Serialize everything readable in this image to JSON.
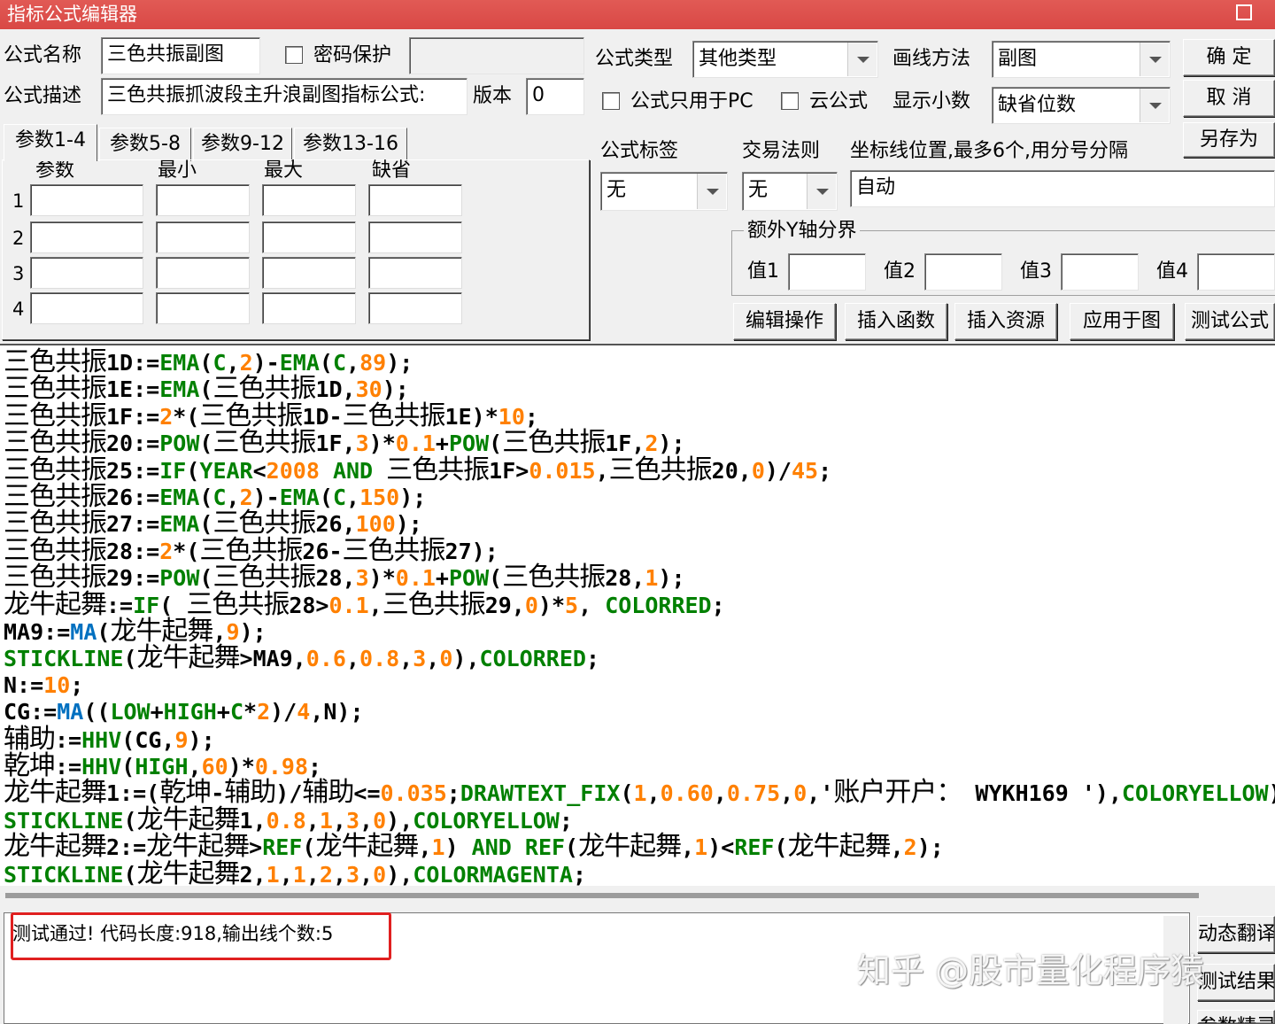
{
  "window": {
    "title": "指标公式编辑器",
    "maximize_icon": "maximize-icon"
  },
  "form": {
    "name_label": "公式名称",
    "name_value": "三色共振副图",
    "password_label": "密码保护",
    "desc_label": "公式描述",
    "desc_value": "三色共振抓波段主升浪副图指标公式:",
    "version_label": "版本",
    "version_value": "0",
    "type_label": "公式类型",
    "type_value": "其他类型",
    "draw_label": "画线方法",
    "draw_value": "副图",
    "pc_only_label": "公式只用于PC",
    "cloud_label": "云公式",
    "decimals_label": "显示小数",
    "decimals_value": "缺省位数",
    "tag_label": "公式标签",
    "tag_value": "无",
    "trade_label": "交易法则",
    "trade_value": "无",
    "axis_label": "坐标线位置,最多6个,用分号分隔",
    "axis_value": "自动",
    "extra_y_label": "额外Y轴分界",
    "val_labels": [
      "值1",
      "值2",
      "值3",
      "值4"
    ]
  },
  "buttons": {
    "ok": "确 定",
    "cancel": "取 消",
    "save_as": "另存为",
    "edit_ops": "编辑操作",
    "insert_func": "插入函数",
    "insert_res": "插入资源",
    "apply": "应用于图",
    "test": "测试公式",
    "dynamic": "动态翻译",
    "test_result": "测试结果",
    "param_tip": "参数精灵"
  },
  "tabs": [
    "参数1-4",
    "参数5-8",
    "参数9-12",
    "参数13-16"
  ],
  "param_headers": [
    "参数",
    "最小",
    "最大",
    "缺省"
  ],
  "param_rows": [
    "1",
    "2",
    "3",
    "4"
  ],
  "code_lines": [
    [
      [
        "z",
        "三色共振"
      ],
      [
        "k",
        "1D:="
      ],
      [
        "g",
        "EMA"
      ],
      [
        "k",
        "("
      ],
      [
        "g",
        "C"
      ],
      [
        "k",
        ","
      ],
      [
        "o",
        "2"
      ],
      [
        "k",
        ")-"
      ],
      [
        "g",
        "EMA"
      ],
      [
        "k",
        "("
      ],
      [
        "g",
        "C"
      ],
      [
        "k",
        ","
      ],
      [
        "o",
        "89"
      ],
      [
        "k",
        ");"
      ]
    ],
    [
      [
        "z",
        "三色共振"
      ],
      [
        "k",
        "1E:="
      ],
      [
        "g",
        "EMA"
      ],
      [
        "k",
        "("
      ],
      [
        "z",
        "三色共振"
      ],
      [
        "k",
        "1D,"
      ],
      [
        "o",
        "30"
      ],
      [
        "k",
        ");"
      ]
    ],
    [
      [
        "z",
        "三色共振"
      ],
      [
        "k",
        "1F:="
      ],
      [
        "o",
        "2"
      ],
      [
        "k",
        "*("
      ],
      [
        "z",
        "三色共振"
      ],
      [
        "k",
        "1D-"
      ],
      [
        "z",
        "三色共振"
      ],
      [
        "k",
        "1E)*"
      ],
      [
        "o",
        "10"
      ],
      [
        "k",
        ";"
      ]
    ],
    [
      [
        "z",
        "三色共振"
      ],
      [
        "k",
        "20:="
      ],
      [
        "g",
        "POW"
      ],
      [
        "k",
        "("
      ],
      [
        "z",
        "三色共振"
      ],
      [
        "k",
        "1F,"
      ],
      [
        "o",
        "3"
      ],
      [
        "k",
        ")*"
      ],
      [
        "o",
        "0.1"
      ],
      [
        "k",
        "+"
      ],
      [
        "g",
        "POW"
      ],
      [
        "k",
        "("
      ],
      [
        "z",
        "三色共振"
      ],
      [
        "k",
        "1F,"
      ],
      [
        "o",
        "2"
      ],
      [
        "k",
        ");"
      ]
    ],
    [
      [
        "z",
        "三色共振"
      ],
      [
        "k",
        "25:="
      ],
      [
        "g",
        "IF"
      ],
      [
        "k",
        "("
      ],
      [
        "g",
        "YEAR"
      ],
      [
        "k",
        "<"
      ],
      [
        "o",
        "2008"
      ],
      [
        "k",
        " "
      ],
      [
        "g",
        "AND"
      ],
      [
        "k",
        " "
      ],
      [
        "z",
        "三色共振"
      ],
      [
        "k",
        "1F>"
      ],
      [
        "o",
        "0.015"
      ],
      [
        "k",
        ","
      ],
      [
        "z",
        "三色共振"
      ],
      [
        "k",
        "20,"
      ],
      [
        "o",
        "0"
      ],
      [
        "k",
        ")/"
      ],
      [
        "o",
        "45"
      ],
      [
        "k",
        ";"
      ]
    ],
    [
      [
        "z",
        "三色共振"
      ],
      [
        "k",
        "26:="
      ],
      [
        "g",
        "EMA"
      ],
      [
        "k",
        "("
      ],
      [
        "g",
        "C"
      ],
      [
        "k",
        ","
      ],
      [
        "o",
        "2"
      ],
      [
        "k",
        ")-"
      ],
      [
        "g",
        "EMA"
      ],
      [
        "k",
        "("
      ],
      [
        "g",
        "C"
      ],
      [
        "k",
        ","
      ],
      [
        "o",
        "150"
      ],
      [
        "k",
        ");"
      ]
    ],
    [
      [
        "z",
        "三色共振"
      ],
      [
        "k",
        "27:="
      ],
      [
        "g",
        "EMA"
      ],
      [
        "k",
        "("
      ],
      [
        "z",
        "三色共振"
      ],
      [
        "k",
        "26,"
      ],
      [
        "o",
        "100"
      ],
      [
        "k",
        ");"
      ]
    ],
    [
      [
        "z",
        "三色共振"
      ],
      [
        "k",
        "28:="
      ],
      [
        "o",
        "2"
      ],
      [
        "k",
        "*("
      ],
      [
        "z",
        "三色共振"
      ],
      [
        "k",
        "26-"
      ],
      [
        "z",
        "三色共振"
      ],
      [
        "k",
        "27);"
      ]
    ],
    [
      [
        "z",
        "三色共振"
      ],
      [
        "k",
        "29:="
      ],
      [
        "g",
        "POW"
      ],
      [
        "k",
        "("
      ],
      [
        "z",
        "三色共振"
      ],
      [
        "k",
        "28,"
      ],
      [
        "o",
        "3"
      ],
      [
        "k",
        ")*"
      ],
      [
        "o",
        "0.1"
      ],
      [
        "k",
        "+"
      ],
      [
        "g",
        "POW"
      ],
      [
        "k",
        "("
      ],
      [
        "z",
        "三色共振"
      ],
      [
        "k",
        "28,"
      ],
      [
        "o",
        "1"
      ],
      [
        "k",
        ");"
      ]
    ],
    [
      [
        "z",
        "龙牛起舞"
      ],
      [
        "k",
        ":="
      ],
      [
        "g",
        "IF"
      ],
      [
        "k",
        "( "
      ],
      [
        "z",
        "三色共振"
      ],
      [
        "k",
        "28>"
      ],
      [
        "o",
        "0.1"
      ],
      [
        "k",
        ","
      ],
      [
        "z",
        "三色共振"
      ],
      [
        "k",
        "29,"
      ],
      [
        "o",
        "0"
      ],
      [
        "k",
        ")*"
      ],
      [
        "o",
        "5"
      ],
      [
        "k",
        ", "
      ],
      [
        "g",
        "COLORRED"
      ],
      [
        "k",
        ";"
      ]
    ],
    [
      [
        "k",
        "MA9:="
      ],
      [
        "b",
        "MA"
      ],
      [
        "k",
        "("
      ],
      [
        "z",
        "龙牛起舞"
      ],
      [
        "k",
        ","
      ],
      [
        "o",
        "9"
      ],
      [
        "k",
        ");"
      ]
    ],
    [
      [
        "g",
        "STICKLINE"
      ],
      [
        "k",
        "("
      ],
      [
        "z",
        "龙牛起舞"
      ],
      [
        "k",
        ">MA9,"
      ],
      [
        "o",
        "0.6"
      ],
      [
        "k",
        ","
      ],
      [
        "o",
        "0.8"
      ],
      [
        "k",
        ","
      ],
      [
        "o",
        "3"
      ],
      [
        "k",
        ","
      ],
      [
        "o",
        "0"
      ],
      [
        "k",
        "),"
      ],
      [
        "g",
        "COLORRED"
      ],
      [
        "k",
        ";"
      ]
    ],
    [
      [
        "k",
        "N:="
      ],
      [
        "o",
        "10"
      ],
      [
        "k",
        ";"
      ]
    ],
    [
      [
        "k",
        "CG:="
      ],
      [
        "b",
        "MA"
      ],
      [
        "k",
        "(("
      ],
      [
        "g",
        "LOW"
      ],
      [
        "k",
        "+"
      ],
      [
        "g",
        "HIGH"
      ],
      [
        "k",
        "+"
      ],
      [
        "g",
        "C"
      ],
      [
        "k",
        "*"
      ],
      [
        "o",
        "2"
      ],
      [
        "k",
        ")/"
      ],
      [
        "o",
        "4"
      ],
      [
        "k",
        ",N);"
      ]
    ],
    [
      [
        "z",
        "辅助"
      ],
      [
        "k",
        ":="
      ],
      [
        "g",
        "HHV"
      ],
      [
        "k",
        "(CG,"
      ],
      [
        "o",
        "9"
      ],
      [
        "k",
        ");"
      ]
    ],
    [
      [
        "z",
        "乾坤"
      ],
      [
        "k",
        ":="
      ],
      [
        "g",
        "HHV"
      ],
      [
        "k",
        "("
      ],
      [
        "g",
        "HIGH"
      ],
      [
        "k",
        ","
      ],
      [
        "o",
        "60"
      ],
      [
        "k",
        ")*"
      ],
      [
        "o",
        "0.98"
      ],
      [
        "k",
        ";"
      ]
    ],
    [
      [
        "z",
        "龙牛起舞"
      ],
      [
        "k",
        "1:=("
      ],
      [
        "z",
        "乾坤"
      ],
      [
        "k",
        "-"
      ],
      [
        "z",
        "辅助"
      ],
      [
        "k",
        ")/"
      ],
      [
        "z",
        "辅助"
      ],
      [
        "k",
        "<="
      ],
      [
        "o",
        "0.035"
      ],
      [
        "k",
        ";"
      ],
      [
        "g",
        "DRAWTEXT_FIX"
      ],
      [
        "k",
        "("
      ],
      [
        "o",
        "1"
      ],
      [
        "k",
        ","
      ],
      [
        "o",
        "0.60"
      ],
      [
        "k",
        ","
      ],
      [
        "o",
        "0.75"
      ],
      [
        "k",
        ","
      ],
      [
        "o",
        "0"
      ],
      [
        "k",
        ",'"
      ],
      [
        "z",
        "账户开户："
      ],
      [
        "k",
        " WYKH169 '),"
      ],
      [
        "g",
        "COLORYELLOW"
      ],
      [
        "k",
        ");"
      ]
    ],
    [
      [
        "g",
        "STICKLINE"
      ],
      [
        "k",
        "("
      ],
      [
        "z",
        "龙牛起舞"
      ],
      [
        "k",
        "1,"
      ],
      [
        "o",
        "0.8"
      ],
      [
        "k",
        ","
      ],
      [
        "o",
        "1"
      ],
      [
        "k",
        ","
      ],
      [
        "o",
        "3"
      ],
      [
        "k",
        ","
      ],
      [
        "o",
        "0"
      ],
      [
        "k",
        "),"
      ],
      [
        "g",
        "COLORYELLOW"
      ],
      [
        "k",
        ";"
      ]
    ],
    [
      [
        "z",
        "龙牛起舞"
      ],
      [
        "k",
        "2:="
      ],
      [
        "z",
        "龙牛起舞"
      ],
      [
        "k",
        ">"
      ],
      [
        "g",
        "REF"
      ],
      [
        "k",
        "("
      ],
      [
        "z",
        "龙牛起舞"
      ],
      [
        "k",
        ","
      ],
      [
        "o",
        "1"
      ],
      [
        "k",
        ") "
      ],
      [
        "g",
        "AND"
      ],
      [
        "k",
        " "
      ],
      [
        "g",
        "REF"
      ],
      [
        "k",
        "("
      ],
      [
        "z",
        "龙牛起舞"
      ],
      [
        "k",
        ","
      ],
      [
        "o",
        "1"
      ],
      [
        "k",
        ")<"
      ],
      [
        "g",
        "REF"
      ],
      [
        "k",
        "("
      ],
      [
        "z",
        "龙牛起舞"
      ],
      [
        "k",
        ","
      ],
      [
        "o",
        "2"
      ],
      [
        "k",
        ");"
      ]
    ],
    [
      [
        "g",
        "STICKLINE"
      ],
      [
        "k",
        "("
      ],
      [
        "z",
        "龙牛起舞"
      ],
      [
        "k",
        "2,"
      ],
      [
        "o",
        "1"
      ],
      [
        "k",
        ","
      ],
      [
        "o",
        "1"
      ],
      [
        "k",
        ","
      ],
      [
        "o",
        "2"
      ],
      [
        "k",
        ","
      ],
      [
        "o",
        "3"
      ],
      [
        "k",
        ","
      ],
      [
        "o",
        "0"
      ],
      [
        "k",
        "),"
      ],
      [
        "g",
        "COLORMAGENTA"
      ],
      [
        "k",
        ";"
      ]
    ]
  ],
  "status": {
    "message": "测试通过! 代码长度:918,输出线个数:5"
  },
  "watermark": "知乎 @股市量化程序猿",
  "colors": {
    "title_bar": "#d9534f",
    "keyword": "#008000",
    "number": "#ff8000",
    "func_blue": "#0070c0",
    "highlight_box": "#e02020"
  }
}
